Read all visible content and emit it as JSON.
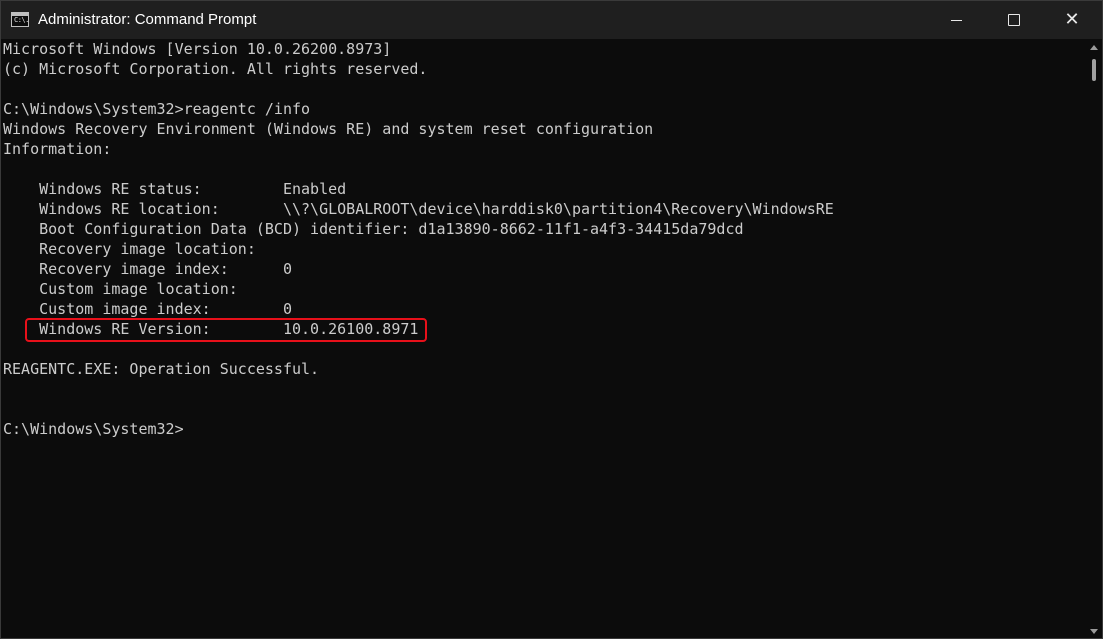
{
  "window": {
    "title": "Administrator: Command Prompt",
    "icon": "cmd-icon",
    "icon_text": "C:\\."
  },
  "controls": {
    "minimize": "minimize-icon",
    "maximize": "maximize-icon",
    "close": "close-icon",
    "close_glyph": "✕"
  },
  "console": {
    "lines": [
      "Microsoft Windows [Version 10.0.26200.8973]",
      "(c) Microsoft Corporation. All rights reserved.",
      "",
      "C:\\Windows\\System32>reagentc /info",
      "Windows Recovery Environment (Windows RE) and system reset configuration",
      "Information:",
      "",
      "    Windows RE status:         Enabled",
      "    Windows RE location:       \\\\?\\GLOBALROOT\\device\\harddisk0\\partition4\\Recovery\\WindowsRE",
      "    Boot Configuration Data (BCD) identifier: d1a13890-8662-11f1-a4f3-34415da79dcd",
      "    Recovery image location:",
      "    Recovery image index:      0",
      "    Custom image location:",
      "    Custom image index:        0",
      "    Windows RE Version:        10.0.26100.8971",
      "",
      "REAGENTC.EXE: Operation Successful.",
      "",
      "",
      "C:\\Windows\\System32>"
    ]
  },
  "colors": {
    "background": "#0c0c0c",
    "text": "#cccccc",
    "titlebar": "#1f1f1f",
    "highlight_border": "#e8101a"
  }
}
